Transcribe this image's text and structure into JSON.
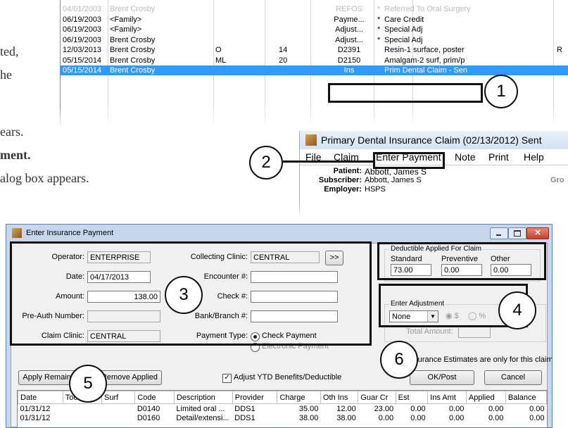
{
  "doc_text": {
    "line1": "ted,",
    "line2": "he",
    "line3": "ears.",
    "line4": "ment.",
    "line5": "alog box appears."
  },
  "ledger": {
    "rows": [
      {
        "date": "04/01/2003",
        "name": "Brent Crosby",
        "s": "",
        "t": "",
        "code": "REFOS",
        "star": "*",
        "desc": "Referred To Oral Surgery",
        "r": "",
        "faded": true
      },
      {
        "date": "06/19/2003",
        "name": "<Family>",
        "s": "",
        "t": "",
        "code": "Payme...",
        "star": "*",
        "desc": "Care Credit",
        "r": "",
        "faded": false
      },
      {
        "date": "06/19/2003",
        "name": "<Family>",
        "s": "",
        "t": "",
        "code": "Adjust...",
        "star": "*",
        "desc": "Special Adj",
        "r": "",
        "faded": false
      },
      {
        "date": "06/19/2003",
        "name": "Brent Crosby",
        "s": "",
        "t": "",
        "code": "Adjust...",
        "star": "*",
        "desc": "Special Adj",
        "r": "",
        "faded": false
      },
      {
        "date": "12/03/2013",
        "name": "Brent Crosby",
        "s": "O",
        "t": "14",
        "code": "D2391",
        "star": "",
        "desc": "Resin-1 surface, poster",
        "r": "R",
        "faded": false
      },
      {
        "date": "05/15/2014",
        "name": "Brent Crosby",
        "s": "ML",
        "t": "20",
        "code": "D2150",
        "star": "",
        "desc": "Amalgam-2 surf, prim/p",
        "r": "",
        "faded": false
      },
      {
        "date": "05/15/2014",
        "name": "Brent Crosby",
        "s": "",
        "t": "",
        "code": "Ins",
        "star": "",
        "desc": "Prim Dental Claim - Sen",
        "r": "",
        "faded": false
      }
    ]
  },
  "claim_window": {
    "title": "Primary Dental Insurance Claim (02/13/2012) Sent",
    "menu": [
      "File",
      "Claim",
      "Enter Payment",
      "Note",
      "Print",
      "Help"
    ],
    "patient_label": "Patient:",
    "patient": "Abbott, James S",
    "subscriber_label": "Subscriber:",
    "subscriber": "Abbott, James S",
    "employer_label": "Employer:",
    "employer": "HSPS",
    "gro": "Gro"
  },
  "dialog": {
    "title": "Enter Insurance Payment",
    "operator_label": "Operator:",
    "operator": "ENTERPRISE",
    "date_label": "Date:",
    "date": "04/17/2013",
    "amount_label": "Amount:",
    "amount": "138.00",
    "preauth_label": "Pre-Auth Number:",
    "preauth": "",
    "claim_clinic_label": "Claim Clinic:",
    "claim_clinic": "CENTRAL",
    "collecting_clinic_label": "Collecting Clinic:",
    "collecting_clinic": "CENTRAL",
    "more_button": ">>",
    "encounter_label": "Encounter #:",
    "check_label": "Check #:",
    "bank_label": "Bank/Branch #:",
    "payment_type_label": "Payment Type:",
    "payment_check": "Check Payment",
    "payment_electronic": "Electronic Payment",
    "deductible_title": "Deductible Applied For Claim",
    "standard_label": "Standard",
    "standard": "73.00",
    "preventive_label": "Preventive",
    "preventive": "0.00",
    "other_label": "Other",
    "other": "0.00",
    "adjustment_title": "Enter Adjustment",
    "adjustment_select": "None",
    "adj_dollar": "$",
    "adj_pct": "%",
    "total_amount_label": "Total Amount:",
    "note": "(Note: Insurance Estimates are only for this claim)",
    "apply_remaining": "Apply Remaining",
    "remove_applied": "Remove Applied",
    "adjust_ytd": "Adjust YTD Benefits/Deductible",
    "ok_post": "OK/Post",
    "cancel": "Cancel",
    "columns": [
      "Date",
      "Tooth",
      "Surf",
      "Code",
      "Description",
      "Provider",
      "Charge",
      "Oth Ins",
      "Guar Cr",
      "Est",
      "Ins Amt",
      "Applied",
      "Balance"
    ],
    "rows": [
      [
        "01/31/12",
        "",
        "",
        "D0140",
        "Limited oral ...",
        "DDS1",
        "35.00",
        "12.00",
        "23.00",
        "0.00",
        "0.00",
        "0.00",
        "0.00"
      ],
      [
        "01/31/12",
        "",
        "",
        "D0160",
        "Detail/extensi...",
        "DDS1",
        "38.00",
        "38.00",
        "0.00",
        "0.00",
        "0.00",
        "0.00",
        "0.00"
      ]
    ]
  },
  "callouts": [
    "1",
    "2",
    "3",
    "4",
    "5",
    "6"
  ]
}
